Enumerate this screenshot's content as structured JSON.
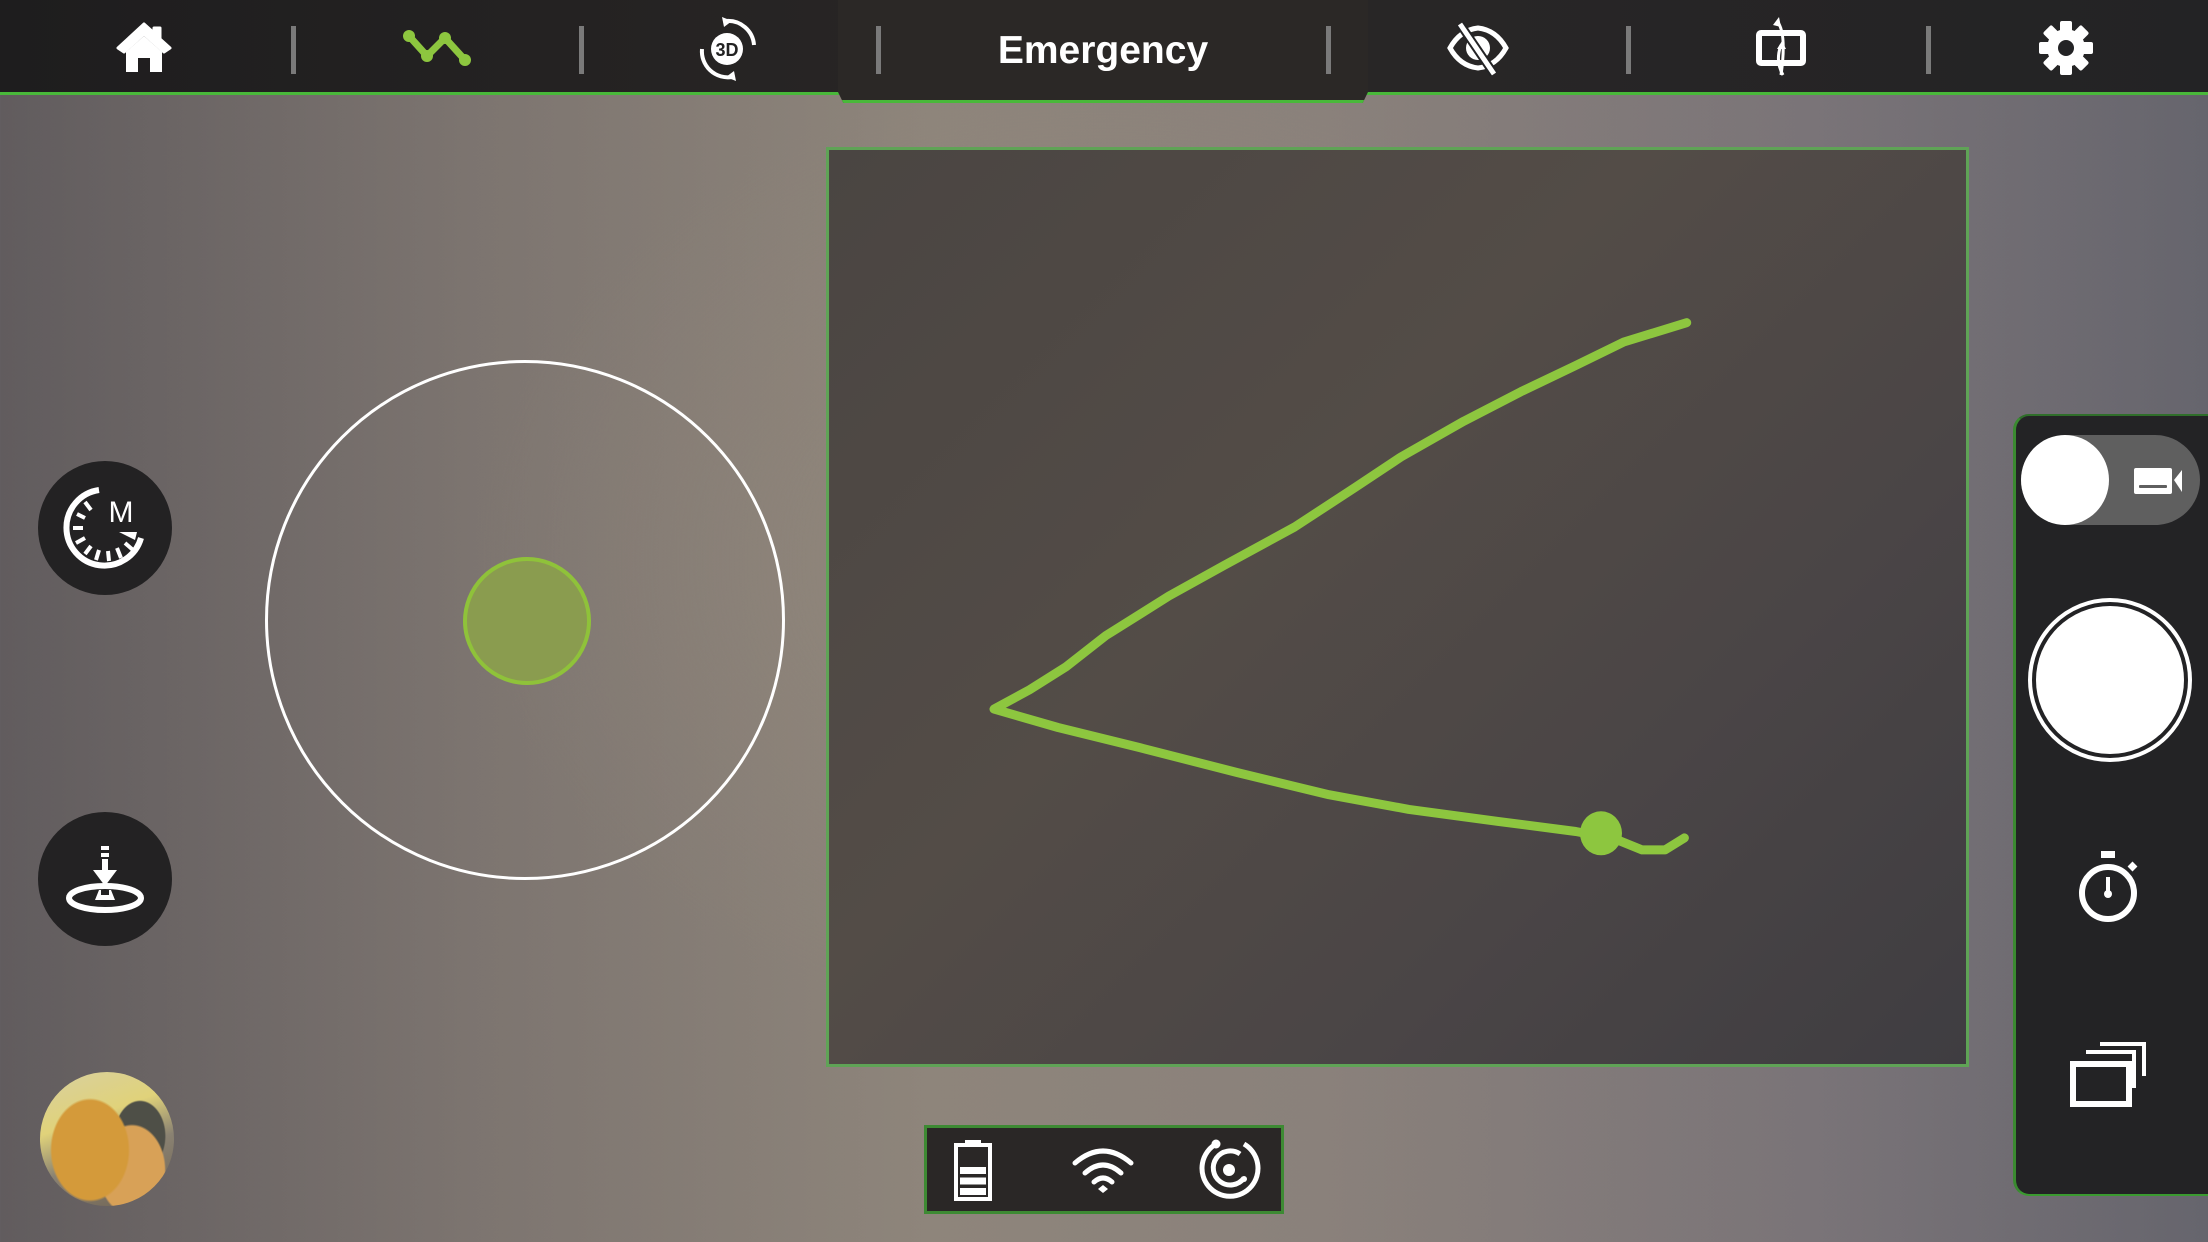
{
  "topbar": {
    "items": [
      {
        "id": "home",
        "icon": "home-icon",
        "active": false
      },
      {
        "id": "path-flight",
        "icon": "path-waypoint-icon",
        "active": true
      },
      {
        "id": "3d-flip",
        "icon": "3d-rotate-icon",
        "active": false
      },
      {
        "id": "emergency",
        "label": "Emergency"
      },
      {
        "id": "hide-view",
        "icon": "eye-off-icon",
        "active": false
      },
      {
        "id": "rotate-screen",
        "icon": "screen-rotate-icon",
        "active": false
      },
      {
        "id": "settings",
        "icon": "gear-icon",
        "active": false
      }
    ],
    "emergency_label": "Emergency"
  },
  "left_controls": {
    "speed_mode_label": "M",
    "speed_mode_icon": "speed-mode-icon",
    "landing_icon": "landing-pad-icon",
    "gallery_thumbnail": "media-thumbnail"
  },
  "joystick": {
    "knob_offset": {
      "x": 0,
      "y": 0
    }
  },
  "flight_path": {
    "description": "Drawn waypoint path",
    "color": "#8dc63f",
    "points_normalized": [
      [
        0.753,
        0.191
      ],
      [
        0.698,
        0.212
      ],
      [
        0.655,
        0.238
      ],
      [
        0.608,
        0.266
      ],
      [
        0.558,
        0.298
      ],
      [
        0.503,
        0.337
      ],
      [
        0.463,
        0.37
      ],
      [
        0.41,
        0.413
      ],
      [
        0.348,
        0.455
      ],
      [
        0.3,
        0.488
      ],
      [
        0.245,
        0.531
      ],
      [
        0.21,
        0.565
      ],
      [
        0.178,
        0.59
      ],
      [
        0.147,
        0.611
      ],
      [
        0.203,
        0.631
      ],
      [
        0.275,
        0.653
      ],
      [
        0.36,
        0.68
      ],
      [
        0.44,
        0.704
      ],
      [
        0.51,
        0.72
      ],
      [
        0.588,
        0.733
      ],
      [
        0.656,
        0.744
      ],
      [
        0.69,
        0.752
      ],
      [
        0.714,
        0.764
      ],
      [
        0.734,
        0.764
      ],
      [
        0.751,
        0.751
      ]
    ],
    "marker_normalized": [
      0.678,
      0.746
    ]
  },
  "right_panel": {
    "mode_toggle": {
      "selected": "photo",
      "other_icon": "video-camera-icon"
    },
    "shutter": "capture-button",
    "timer_icon": "stopwatch-icon",
    "gallery_icon": "gallery-stack-icon"
  },
  "status_bar": {
    "battery_level": 0.6,
    "battery_icon": "battery-icon",
    "wifi_icon": "wifi-icon",
    "signal_icon": "gps-signal-icon"
  },
  "colors": {
    "accent_green": "#8dc63f",
    "bar_border_green": "#49b83a",
    "bar_bg": "#232325"
  }
}
